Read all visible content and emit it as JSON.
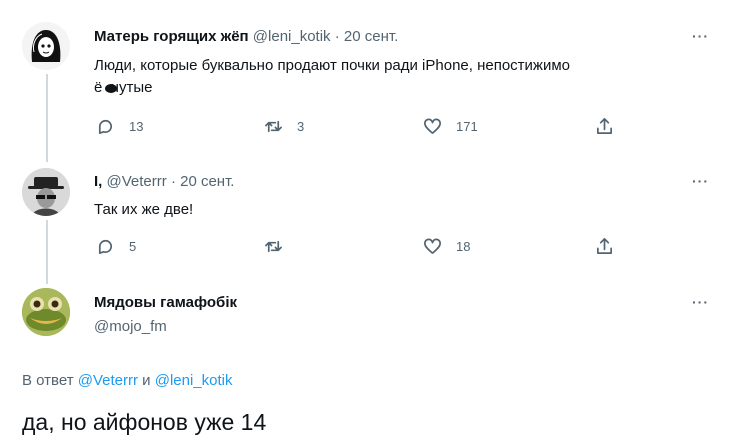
{
  "tweet1": {
    "name": "Матерь горящих жёп",
    "handle": "@leni_kotik",
    "date": "· 20 сент.",
    "text_line1": "Люди, которые буквально продают почки ради iPhone, непостижимо",
    "text_line2": "ё  нутые",
    "reply_count": "13",
    "retweet_count": "3",
    "like_count": "171"
  },
  "tweet2": {
    "name": "I,",
    "handle": "@Veterrr",
    "date": "· 20 сент.",
    "text": "Так их же две!",
    "reply_count": "5",
    "retweet_count": "",
    "like_count": "18"
  },
  "tweet3": {
    "name": "Мядовы гамафобік",
    "handle": "@mojo_fm",
    "reply_prefix": "В ответ",
    "reply_user1": "@Veterrr",
    "reply_and": "и",
    "reply_user2": "@leni_kotik",
    "text": "да, но айфонов уже 14"
  },
  "more_label": "···",
  "icons": [
    "more-icon",
    "reply-icon",
    "retweet-icon",
    "like-icon",
    "share-icon"
  ],
  "colors": {
    "link": "#1d9bf0",
    "muted": "#536471",
    "text": "#0f1419",
    "line": "#cfd9de"
  }
}
